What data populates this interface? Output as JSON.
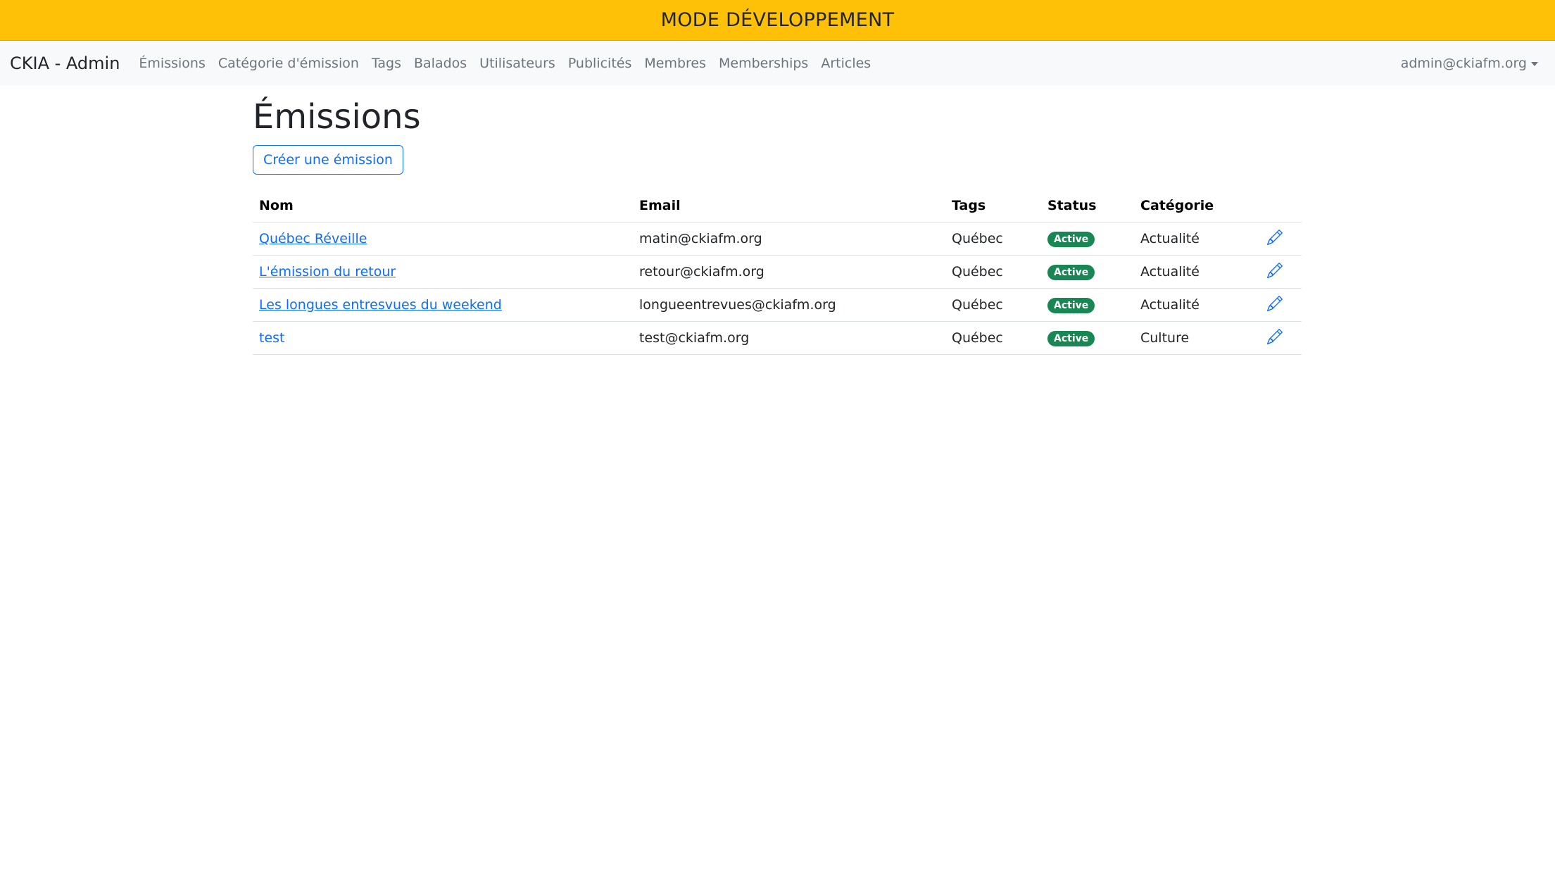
{
  "banner": {
    "text": "MODE DÉVELOPPEMENT"
  },
  "navbar": {
    "brand": "CKIA - Admin",
    "links": [
      "Émissions",
      "Catégorie d'émission",
      "Tags",
      "Balados",
      "Utilisateurs",
      "Publicités",
      "Membres",
      "Memberships",
      "Articles"
    ],
    "user": "admin@ckiafm.org"
  },
  "page": {
    "title": "Émissions",
    "create_button": "Créer une émission"
  },
  "table": {
    "headers": [
      "Nom",
      "Email",
      "Tags",
      "Status",
      "Catégorie"
    ],
    "rows": [
      {
        "name": "Québec Réveille",
        "email": "matin@ckiafm.org",
        "tags": "Québec",
        "status": "Active",
        "category": "Actualité"
      },
      {
        "name": "L'émission du retour",
        "email": "retour@ckiafm.org",
        "tags": "Québec",
        "status": "Active",
        "category": "Actualité"
      },
      {
        "name": "Les longues entresvues du weekend",
        "email": "longueentrevues@ckiafm.org",
        "tags": "Québec",
        "status": "Active",
        "category": "Actualité"
      },
      {
        "name": "test",
        "email": "test@ckiafm.org",
        "tags": "Québec",
        "status": "Active",
        "category": "Culture"
      }
    ]
  },
  "colors": {
    "banner": "#ffc107",
    "navbar": "#f8f9fa",
    "link": "#0d6efd",
    "badge_active": "#198754"
  },
  "icons": {
    "edit": "pencil-icon",
    "user_menu": "caret-down-icon"
  }
}
